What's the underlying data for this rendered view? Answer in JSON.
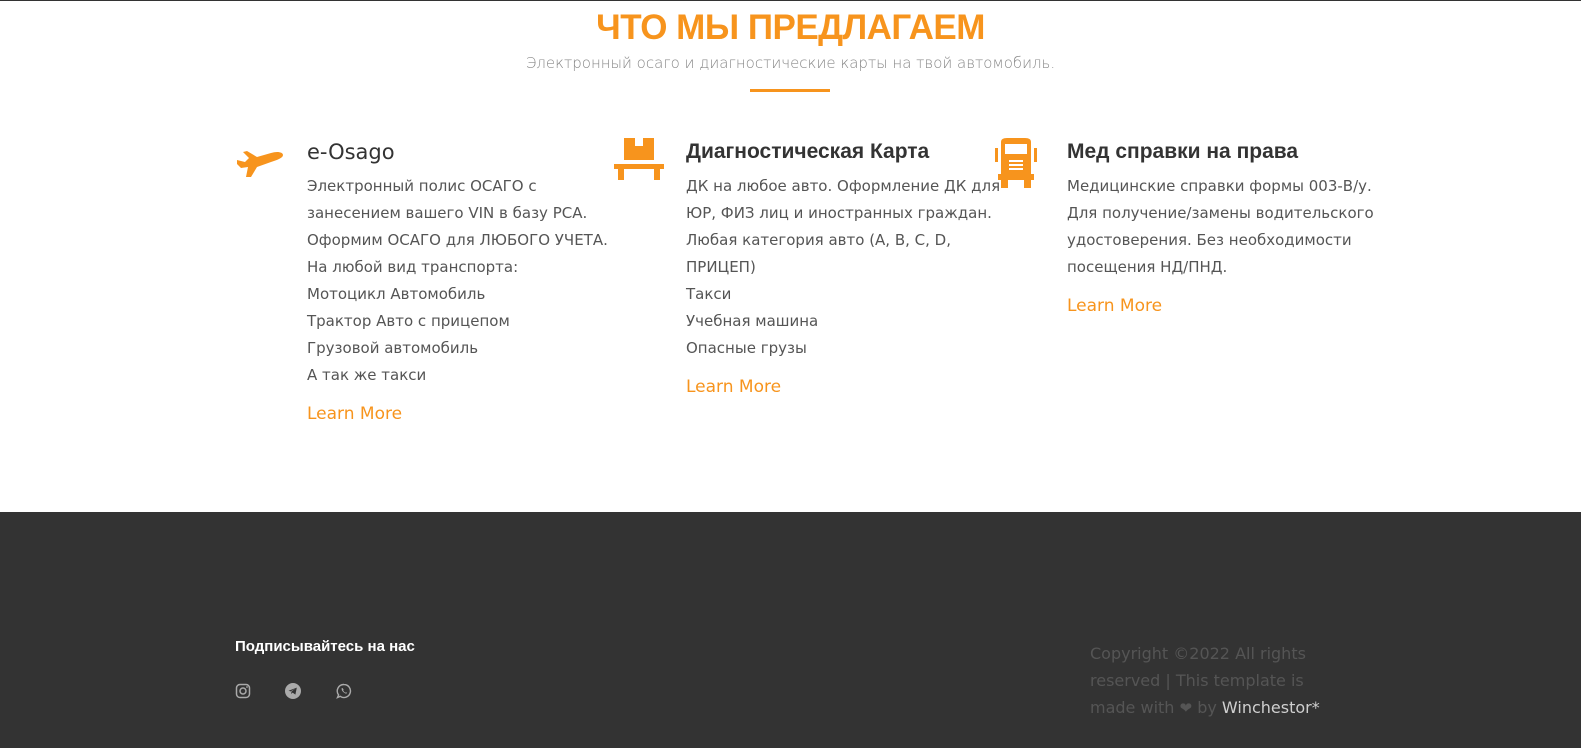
{
  "section": {
    "title": "ЧТО МЫ ПРЕДЛАГАЕМ",
    "subtitle": "Электронный осаго и диагностические карты на твой автомобиль."
  },
  "services": [
    {
      "icon": "airplane-icon",
      "title": "e-Osago",
      "lines": [
        "Электронный полис ОСАГО с",
        "занесением вашего VIN в базу РСА.",
        "Оформим ОСАГО для ЛЮБОГО УЧЕТА.",
        "На любой вид транспорта:",
        "Мотоцикл Автомобиль",
        "Трактор Авто с прицепом",
        "Грузовой автомобиль",
        "А так же такси"
      ],
      "link": "Learn More"
    },
    {
      "icon": "forklift-box-icon",
      "title": "Диагностическая Карта",
      "lines": [
        "ДК на любое авто. Оформление ДК для",
        "ЮР, ФИЗ лиц и иностранных граждан.",
        "Любая категория авто (A, B, C, D,",
        "ПРИЦЕП)",
        "Такси",
        "Учебная машина",
        "Опасные грузы"
      ],
      "link": "Learn More"
    },
    {
      "icon": "truck-icon",
      "title": "Мед справки на права",
      "lines": [
        "Медицинские справки формы 003-В/у.",
        "Для получение/замены водительского",
        "удостоверения. Без необходимости",
        "посещения НД/ПНД."
      ],
      "link": "Learn More"
    }
  ],
  "footer": {
    "follow_title": "Подписывайтесь на нас",
    "social": [
      "instagram-icon",
      "telegram-icon",
      "whatsapp-icon"
    ],
    "copyright_lines": [
      "Copyright ©2022 All rights",
      "reserved | This template is"
    ],
    "copyright_made": "made with",
    "copyright_by": "by",
    "brand": "Winchestor*"
  },
  "colors": {
    "accent": "#f7941d",
    "footer_bg": "#333333"
  }
}
